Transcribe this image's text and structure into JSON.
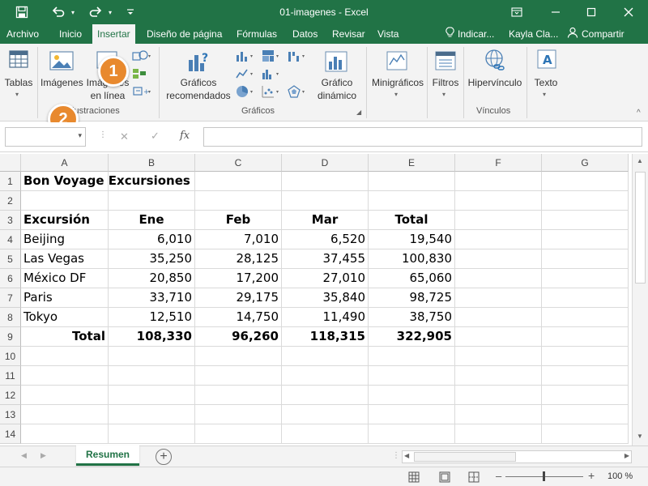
{
  "window": {
    "title": "01-imagenes  -  Excel",
    "user": "Kayla Cla...",
    "share_label": "Compartir",
    "tell_me": "Indicar..."
  },
  "tabs": [
    "Archivo",
    "Inicio",
    "Insertar",
    "Diseño de página",
    "Fórmulas",
    "Datos",
    "Revisar",
    "Vista"
  ],
  "ribbon": {
    "tablas": "Tablas",
    "imagenes": "Imágenes",
    "imagenes_linea_1": "Imágenes",
    "imagenes_linea_2": "en línea",
    "group_ilustraciones": "Ilustraciones",
    "graficos_rec_1": "Gráficos",
    "graficos_rec_2": "recomendados",
    "grafico_din_1": "Gráfico",
    "grafico_din_2": "dinámico",
    "group_graficos": "Gráficos",
    "minigraficos": "Minigráficos",
    "filtros": "Filtros",
    "hipervinculo": "Hipervínculo",
    "group_vinculos": "Vínculos",
    "texto": "Texto"
  },
  "callouts": [
    "1",
    "2"
  ],
  "formula_bar": {
    "fx": "fx",
    "name_box": "",
    "content": ""
  },
  "columns": [
    "A",
    "B",
    "C",
    "D",
    "E",
    "F",
    "G"
  ],
  "rows": [
    "1",
    "2",
    "3",
    "4",
    "5",
    "6",
    "7",
    "8",
    "9",
    "10",
    "11",
    "12",
    "13",
    "14"
  ],
  "sheet": {
    "title": "Bon Voyage Excursiones",
    "headers": [
      "Excursión",
      "Ene",
      "Feb",
      "Mar",
      "Total"
    ],
    "data": [
      [
        "Beijing",
        "6,010",
        "7,010",
        "6,520",
        "19,540"
      ],
      [
        "Las Vegas",
        "35,250",
        "28,125",
        "37,455",
        "100,830"
      ],
      [
        "México DF",
        "20,850",
        "17,200",
        "27,010",
        "65,060"
      ],
      [
        "Paris",
        "33,710",
        "29,175",
        "35,840",
        "98,725"
      ],
      [
        "Tokyo",
        "12,510",
        "14,750",
        "11,490",
        "38,750"
      ]
    ],
    "totals": [
      "Total",
      "108,330",
      "96,260",
      "118,315",
      "322,905"
    ]
  },
  "sheet_tab": "Resumen",
  "zoom": "100 %"
}
